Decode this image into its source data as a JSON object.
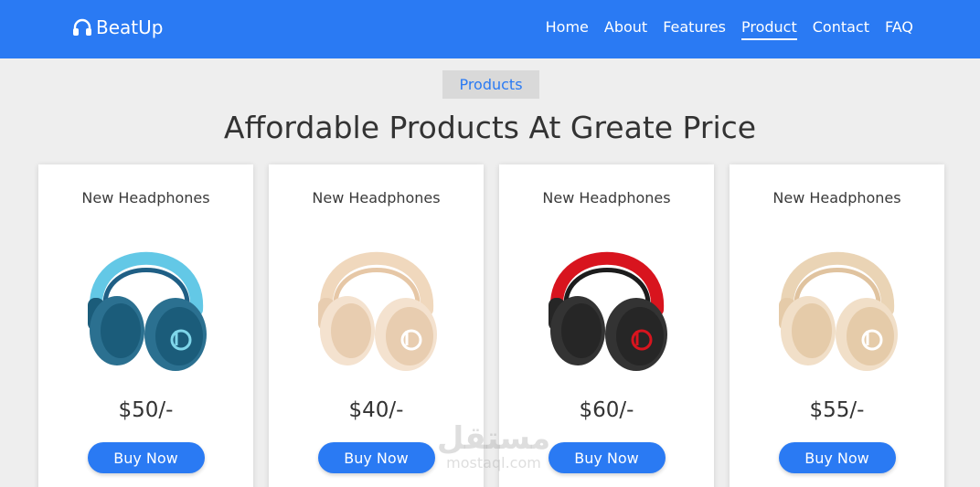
{
  "header": {
    "brand": "BeatUp",
    "nav": [
      "Home",
      "About",
      "Features",
      "Product",
      "Contact",
      "FAQ"
    ],
    "active": "Product",
    "color": "#2a7af3"
  },
  "section": {
    "tag": "Products",
    "title": "Affordable Products At Greate Price"
  },
  "products": [
    {
      "name": "New Headphones",
      "price": "$50/-",
      "button": "Buy Now",
      "colors": {
        "band": "#63c8e6",
        "band2": "#1f5f85",
        "cup": "#1b5c7a",
        "pad": "#2b7090",
        "logo": "#7fd6ea"
      }
    },
    {
      "name": "New Headphones",
      "price": "$40/-",
      "button": "Buy Now",
      "colors": {
        "band": "#f0d8bd",
        "band2": "#e6c7a6",
        "cup": "#e8cdb0",
        "pad": "#f4e2cf",
        "logo": "#ffffff"
      }
    },
    {
      "name": "New Headphones",
      "price": "$60/-",
      "button": "Buy Now",
      "colors": {
        "band": "#d8141e",
        "band2": "#1c1c1c",
        "cup": "#262626",
        "pad": "#333333",
        "logo": "#d8141e"
      }
    },
    {
      "name": "New Headphones",
      "price": "$55/-",
      "button": "Buy Now",
      "colors": {
        "band": "#ead4b5",
        "band2": "#e0c39f",
        "cup": "#e5cba9",
        "pad": "#f1dfc8",
        "logo": "#ffffff"
      }
    }
  ],
  "watermark": {
    "arabic": "مستقل",
    "latin": "mostaql.com"
  }
}
